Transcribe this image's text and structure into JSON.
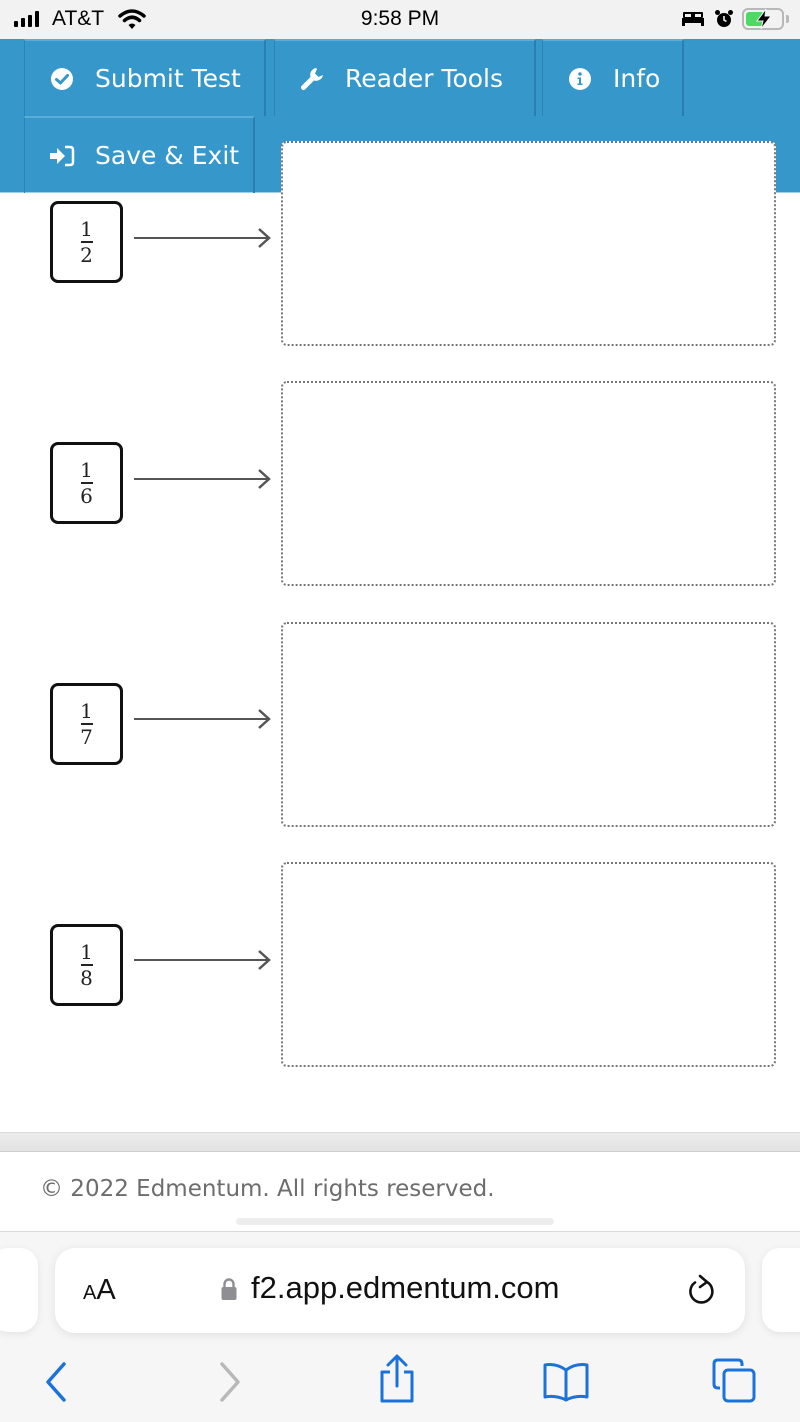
{
  "status_bar": {
    "carrier": "AT&T",
    "time": "9:58 PM",
    "icons": [
      "signal-icon",
      "wifi-icon",
      "sleep-bed-icon",
      "alarm-icon",
      "battery-charging-icon"
    ],
    "battery_color": "#4cd964"
  },
  "toolbar": {
    "background": "#3697cb",
    "buttons": [
      {
        "label": "Submit Test",
        "icon": "check-circle-icon"
      },
      {
        "label": "Reader Tools",
        "icon": "wrench-icon"
      },
      {
        "label": "Info",
        "icon": "info-circle-icon"
      },
      {
        "label": "Save & Exit",
        "icon": "sign-in-icon"
      }
    ]
  },
  "matching": {
    "items": [
      {
        "numerator": "1",
        "denominator": "2",
        "answer": ""
      },
      {
        "numerator": "1",
        "denominator": "6",
        "answer": ""
      },
      {
        "numerator": "1",
        "denominator": "7",
        "answer": ""
      },
      {
        "numerator": "1",
        "denominator": "8",
        "answer": ""
      }
    ]
  },
  "footer": {
    "copyright": "© 2022 Edmentum. All rights reserved."
  },
  "browser": {
    "text_size_small": "A",
    "text_size_big": "A",
    "url": "f2.app.edmentum.com",
    "accent": "#1a73d9",
    "nav": [
      "back-icon",
      "forward-icon",
      "share-icon",
      "bookmarks-icon",
      "tabs-icon"
    ]
  }
}
